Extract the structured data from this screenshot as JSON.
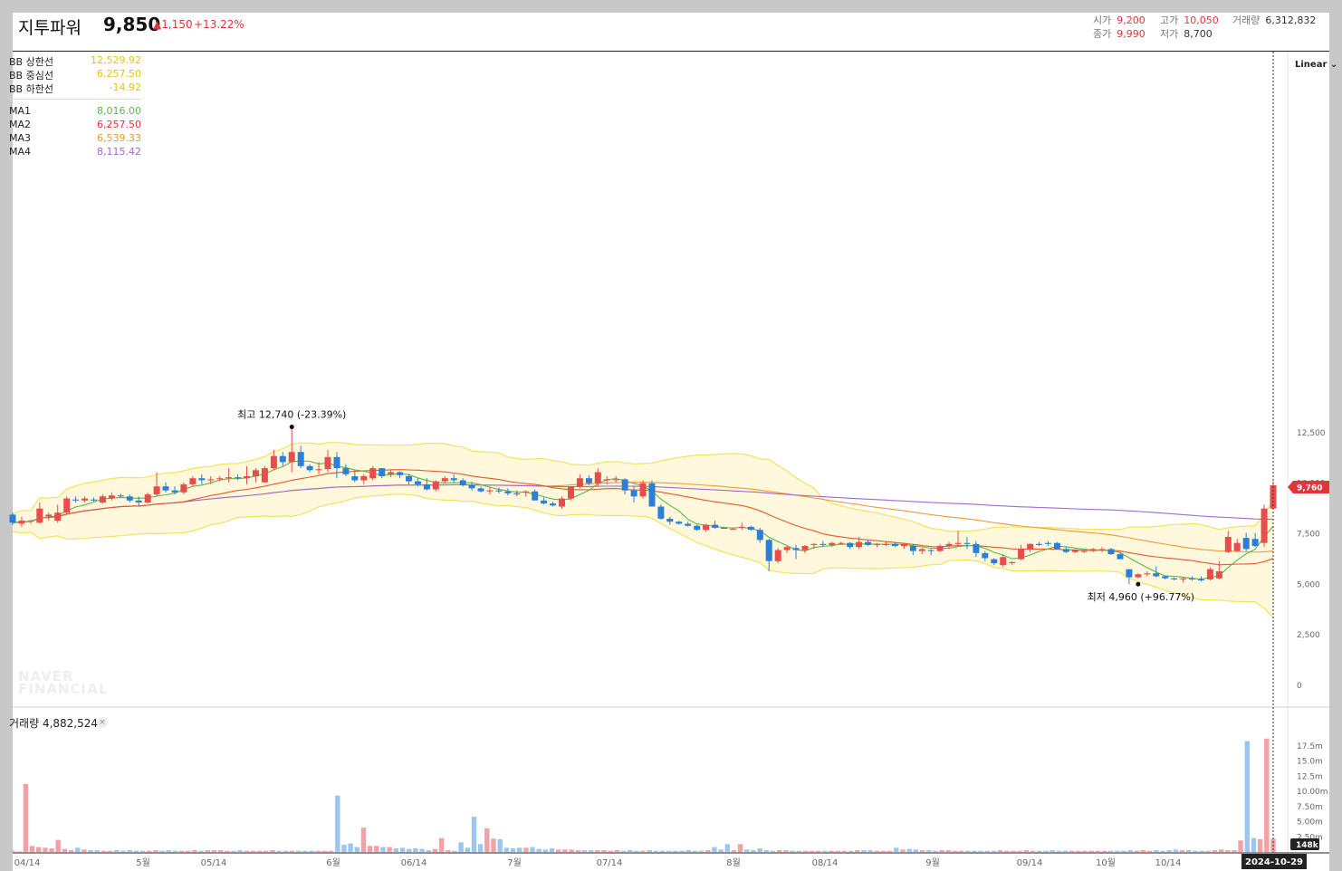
{
  "header": {
    "stock_name": "지투파워",
    "price": "9,850",
    "change": "▲1,150",
    "change_pct": "+13.22%",
    "open_label": "시가",
    "open": "9,200",
    "high_label": "고가",
    "high": "10,050",
    "close_label": "종가",
    "close": "9,990",
    "low_label": "저가",
    "low": "8,700",
    "volume_label": "거래량",
    "volume": "6,312,832"
  },
  "legend": {
    "bb_upper": {
      "label": "BB 상한선",
      "value": "12,529.92"
    },
    "bb_mid": {
      "label": "BB 중심선",
      "value": "6,257.50"
    },
    "bb_lower": {
      "label": "BB 하한선",
      "value": "-14.92"
    },
    "ma1": {
      "label": "MA1",
      "value": "8,016.00"
    },
    "ma2": {
      "label": "MA2",
      "value": "6,257.50"
    },
    "ma3": {
      "label": "MA3",
      "value": "6,539.33"
    },
    "ma4": {
      "label": "MA4",
      "value": "8,115.42"
    }
  },
  "scale_mode": "Linear",
  "volume_panel": {
    "title": "거래량",
    "value": "4,882,524",
    "close_icon": "close-icon"
  },
  "watermark": [
    "NAVER",
    "FINANCIAL"
  ],
  "colors": {
    "up": "#e94c4c",
    "down": "#2c7fd6",
    "vol_up": "#f2a1a5",
    "vol_down": "#9cc6f0",
    "bb_band": "#f2e35a",
    "bb_fill": "#fff8dc",
    "ma1": "#5fb548",
    "ma2": "#e05a2b",
    "ma3": "#ee9a3a",
    "ma4": "#a06ad0"
  },
  "chart_data": {
    "type": "candlestick",
    "price_axis": {
      "ticks": [
        "12,500",
        "10,000",
        "7,500",
        "5,000",
        "2,500",
        "0"
      ],
      "range": [
        -400,
        14800
      ]
    },
    "volume_axis": {
      "ticks": [
        "17.5m",
        "15.0m",
        "12.5m",
        "10.00m",
        "7.50m",
        "5.00m",
        "2.50m"
      ]
    },
    "x_ticks": [
      "04/14",
      "5월",
      "05/14",
      "6월",
      "06/14",
      "7월",
      "07/14",
      "8월",
      "08/14",
      "9월",
      "09/14",
      "10월",
      "10/14"
    ],
    "last_price_tag": "9,760",
    "last_volume_tag": "148k",
    "date_tag": "2024-10-29",
    "max_annotation": "최고 12,740 (-23.39%)",
    "min_annotation": "최저 4,960 (+96.77%)",
    "candles": [
      [
        8400,
        8500,
        7900,
        8000
      ],
      [
        7950,
        8300,
        7800,
        8100
      ],
      [
        8050,
        8150,
        7950,
        8100
      ],
      [
        8000,
        9000,
        7950,
        8700
      ],
      [
        8300,
        8500,
        8100,
        8400
      ],
      [
        8100,
        8900,
        8000,
        8500
      ],
      [
        8500,
        9300,
        8400,
        9200
      ],
      [
        9150,
        9300,
        9000,
        9100
      ],
      [
        9100,
        9300,
        9000,
        9200
      ],
      [
        9150,
        9250,
        9050,
        9100
      ],
      [
        9000,
        9400,
        8950,
        9300
      ],
      [
        9200,
        9500,
        9100,
        9350
      ],
      [
        9350,
        9450,
        9250,
        9300
      ],
      [
        9300,
        9400,
        9000,
        9100
      ],
      [
        9100,
        9300,
        8800,
        9000
      ],
      [
        9000,
        9500,
        8950,
        9400
      ],
      [
        9400,
        10500,
        9300,
        9800
      ],
      [
        9800,
        10000,
        9500,
        9600
      ],
      [
        9600,
        9800,
        9400,
        9500
      ],
      [
        9500,
        10000,
        9400,
        9900
      ],
      [
        9900,
        10300,
        9800,
        10200
      ],
      [
        10200,
        10400,
        9900,
        10100
      ],
      [
        10100,
        10300,
        9900,
        10150
      ],
      [
        10150,
        10300,
        10050,
        10200
      ],
      [
        10200,
        10700,
        10000,
        10250
      ],
      [
        10250,
        10400,
        10100,
        10200
      ],
      [
        10200,
        10800,
        9900,
        10300
      ],
      [
        10300,
        10700,
        10000,
        10600
      ],
      [
        10000,
        10800,
        10000,
        10700
      ],
      [
        10700,
        11600,
        10600,
        11300
      ],
      [
        11300,
        11500,
        10800,
        11000
      ],
      [
        11000,
        12740,
        10500,
        11500
      ],
      [
        11500,
        11800,
        10700,
        10800
      ],
      [
        10800,
        10900,
        10500,
        10600
      ],
      [
        10600,
        11000,
        10400,
        10650
      ],
      [
        10650,
        11600,
        10500,
        11250
      ],
      [
        11250,
        11500,
        10200,
        10700
      ],
      [
        10700,
        10900,
        10300,
        10400
      ],
      [
        10300,
        10600,
        10000,
        10100
      ],
      [
        10100,
        10400,
        9900,
        10300
      ],
      [
        10200,
        10800,
        10100,
        10700
      ],
      [
        10700,
        10700,
        10200,
        10300
      ],
      [
        10400,
        10600,
        10250,
        10500
      ],
      [
        10500,
        10550,
        10200,
        10350
      ],
      [
        10300,
        10400,
        9900,
        10050
      ],
      [
        10050,
        10200,
        9800,
        9900
      ],
      [
        9900,
        10200,
        9600,
        9650
      ],
      [
        9650,
        10100,
        9550,
        10050
      ],
      [
        10050,
        10300,
        9950,
        10200
      ],
      [
        10200,
        10400,
        10000,
        10100
      ],
      [
        10100,
        10200,
        9800,
        9850
      ],
      [
        9850,
        10000,
        9600,
        9700
      ],
      [
        9700,
        9800,
        9500,
        9550
      ],
      [
        9550,
        9800,
        9400,
        9600
      ],
      [
        9600,
        9750,
        9450,
        9550
      ],
      [
        9550,
        9700,
        9350,
        9450
      ],
      [
        9450,
        9600,
        9300,
        9400
      ],
      [
        9500,
        9600,
        9300,
        9550
      ],
      [
        9550,
        9650,
        9100,
        9100
      ],
      [
        9100,
        9250,
        8900,
        8950
      ],
      [
        8950,
        9050,
        8800,
        8850
      ],
      [
        8800,
        9300,
        8700,
        9200
      ],
      [
        9200,
        9800,
        9100,
        9800
      ],
      [
        9800,
        10400,
        9700,
        10200
      ],
      [
        10200,
        10350,
        9850,
        9950
      ],
      [
        9950,
        10700,
        9800,
        10500
      ],
      [
        10100,
        10300,
        9900,
        10150
      ],
      [
        10150,
        10300,
        10000,
        10150
      ],
      [
        10150,
        10200,
        9400,
        9600
      ],
      [
        9600,
        9800,
        9000,
        9300
      ],
      [
        9300,
        10100,
        9200,
        9950
      ],
      [
        9950,
        10100,
        8800,
        8800
      ],
      [
        8800,
        8900,
        8150,
        8200
      ],
      [
        8200,
        8300,
        7900,
        8050
      ],
      [
        8050,
        8100,
        7900,
        7950
      ],
      [
        7950,
        8050,
        7800,
        7850
      ],
      [
        7850,
        7900,
        7600,
        7650
      ],
      [
        7650,
        7950,
        7550,
        7900
      ],
      [
        7900,
        8100,
        7700,
        7750
      ],
      [
        7750,
        7800,
        7700,
        7700
      ],
      [
        7700,
        7750,
        7650,
        7700
      ],
      [
        7750,
        8000,
        7650,
        7800
      ],
      [
        7800,
        7850,
        7600,
        7650
      ],
      [
        7650,
        7750,
        7000,
        7150
      ],
      [
        7150,
        7200,
        5600,
        6100
      ],
      [
        6100,
        6750,
        6000,
        6650
      ],
      [
        6650,
        6900,
        6500,
        6800
      ],
      [
        6750,
        6900,
        6200,
        6650
      ],
      [
        6650,
        6900,
        6500,
        6850
      ],
      [
        6900,
        7000,
        6700,
        6950
      ],
      [
        6950,
        7100,
        6800,
        6900
      ],
      [
        6900,
        7050,
        6800,
        7000
      ],
      [
        7000,
        7050,
        6900,
        7000
      ],
      [
        7000,
        7050,
        6700,
        6800
      ],
      [
        6800,
        7300,
        6700,
        7050
      ],
      [
        7050,
        7150,
        6850,
        6900
      ],
      [
        6900,
        7000,
        6800,
        6950
      ],
      [
        6900,
        7050,
        6850,
        6950
      ],
      [
        6950,
        7050,
        6800,
        6850
      ],
      [
        6850,
        7000,
        6700,
        6950
      ],
      [
        6850,
        6950,
        6400,
        6600
      ],
      [
        6600,
        6750,
        6450,
        6700
      ],
      [
        6650,
        6700,
        6400,
        6600
      ],
      [
        6600,
        6950,
        6550,
        6850
      ],
      [
        6850,
        7050,
        6700,
        6950
      ],
      [
        6950,
        7600,
        6850,
        7000
      ],
      [
        7000,
        7300,
        6700,
        6950
      ],
      [
        6950,
        7100,
        6300,
        6500
      ],
      [
        6500,
        6600,
        6100,
        6250
      ],
      [
        6200,
        6250,
        5900,
        6000
      ],
      [
        5900,
        6450,
        5800,
        6300
      ],
      [
        6000,
        6100,
        5900,
        6050
      ],
      [
        6200,
        6900,
        6150,
        6700
      ],
      [
        6700,
        7000,
        6550,
        6950
      ],
      [
        6950,
        7050,
        6850,
        6900
      ],
      [
        7000,
        7100,
        6850,
        6950
      ],
      [
        7000,
        7050,
        6700,
        6700
      ],
      [
        6700,
        6800,
        6500,
        6550
      ],
      [
        6550,
        6700,
        6500,
        6650
      ],
      [
        6600,
        6650,
        6500,
        6600
      ],
      [
        6600,
        6750,
        6550,
        6700
      ],
      [
        6700,
        6800,
        6550,
        6700
      ],
      [
        6700,
        6750,
        6400,
        6450
      ],
      [
        6450,
        6550,
        6200,
        6200
      ],
      [
        5700,
        5700,
        4960,
        5300
      ],
      [
        5300,
        5500,
        5250,
        5450
      ],
      [
        5450,
        5600,
        5350,
        5500
      ],
      [
        5500,
        5850,
        5300,
        5350
      ],
      [
        5350,
        5400,
        5200,
        5250
      ],
      [
        5250,
        5300,
        5150,
        5200
      ],
      [
        5200,
        5300,
        5050,
        5250
      ],
      [
        5250,
        5350,
        5150,
        5200
      ],
      [
        5200,
        5350,
        5100,
        5150
      ],
      [
        5200,
        5800,
        5150,
        5700
      ],
      [
        5250,
        6100,
        5200,
        5600
      ],
      [
        6550,
        7600,
        6500,
        7300
      ],
      [
        6600,
        7200,
        6550,
        7000
      ],
      [
        7250,
        7500,
        6600,
        6700
      ],
      [
        7200,
        7500,
        6800,
        6850
      ],
      [
        7000,
        8900,
        6800,
        8700
      ],
      [
        8700,
        10050,
        8700,
        9850
      ]
    ],
    "volumes_m": [
      0.2,
      0.1,
      11.2,
      1.0,
      0.8,
      0.7,
      0.6,
      2.0,
      0.5,
      0.3,
      0.7,
      0.4,
      0.3,
      0.3,
      0.2,
      0.2,
      0.3,
      0.2,
      0.3,
      0.2,
      0.2,
      0.2,
      0.3,
      0.2,
      0.3,
      0.2,
      0.2,
      0.2,
      0.3,
      0.2,
      0.3,
      0.3,
      0.3,
      0.2,
      0.2,
      0.3,
      0.2,
      0.2,
      0.2,
      0.2,
      0.3,
      0.2,
      0.2,
      0.2,
      0.2,
      0.2,
      0.2,
      0.2,
      0.2,
      0.2,
      9.3,
      1.2,
      1.4,
      0.8,
      4.0,
      1.0,
      1.0,
      0.8,
      0.8,
      0.6,
      0.7,
      0.5,
      0.6,
      0.5,
      0.3,
      0.5,
      2.3,
      0.3,
      0.2,
      1.6,
      0.7,
      5.8,
      1.3,
      3.9,
      2.2,
      2.1,
      0.7,
      0.6,
      0.7,
      0.7,
      0.8,
      0.5,
      0.4,
      0.6,
      0.4,
      0.4,
      0.4,
      0.3,
      0.3,
      0.3,
      0.3,
      0.3,
      0.2,
      0.3,
      0.2,
      0.3,
      0.2,
      0.2,
      0.3,
      0.2,
      0.2,
      0.2,
      0.2,
      0.2,
      0.3,
      0.2,
      0.2,
      0.3,
      0.8,
      0.4,
      1.3,
      0.3,
      1.3,
      0.4,
      0.3,
      0.6,
      0.3,
      0.2,
      0.3,
      0.3,
      0.2,
      0.2,
      0.2,
      0.2,
      0.2,
      0.2,
      0.2,
      0.2,
      0.2,
      0.2,
      0.3,
      0.3,
      0.3,
      0.2,
      0.2,
      0.2,
      0.7,
      0.4,
      0.5,
      0.4,
      0.3,
      0.3,
      0.2,
      0.3,
      0.3,
      0.2,
      0.2,
      0.2,
      0.2,
      0.2,
      0.2,
      0.2,
      0.3,
      0.2,
      0.2,
      0.2,
      0.3,
      0.2,
      0.2,
      0.2,
      0.3,
      0.2,
      0.2,
      0.2,
      0.2,
      0.2,
      0.2,
      0.2,
      0.2,
      0.2,
      0.2,
      0.2,
      0.3,
      0.2,
      0.3,
      0.2,
      0.3,
      0.2,
      0.3,
      0.4,
      0.3,
      0.3,
      0.2,
      0.2,
      0.2,
      0.3,
      0.4,
      0.3,
      0.3,
      1.9,
      18.3,
      2.3,
      2.1,
      18.7,
      2.2
    ]
  }
}
